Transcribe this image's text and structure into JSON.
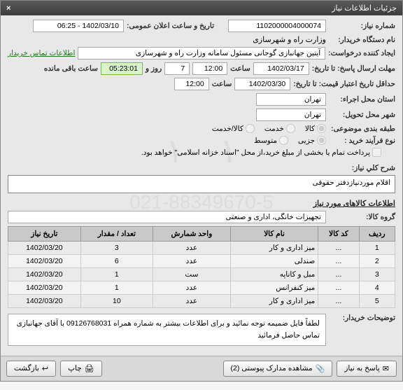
{
  "window": {
    "title": "جزئیات اطلاعات نیاز"
  },
  "fields": {
    "need_no_label": "شماره نیاز:",
    "need_no": "1102000004000074",
    "announce_label": "تاریخ و ساعت اعلان عمومی:",
    "announce_value": "1402/03/10 - 06:25",
    "buyer_label": "نام دستگاه خریدار:",
    "buyer_value": "وزارت راه و شهرسازی",
    "creator_label": "ایجاد کننده درخواست:",
    "creator_value": "آیتین جهانبازی گوجانی مسئول سامانه وزارت راه و شهرسازی",
    "contact_link": "اطلاعات تماس خریدار",
    "deadline_from_label": "مهلت ارسال پاسخ: تا تاریخ:",
    "deadline_date": "1402/03/17",
    "time_label": "ساعت",
    "deadline_time": "12:00",
    "days_label": "روز و",
    "days_value": "7",
    "remain_label": "ساعت باقی مانده",
    "remain_value": "05:23:01",
    "validity_label": "حداقل تاریخ اعتبار قیمت: تا تاریخ:",
    "validity_date": "1402/03/30",
    "validity_time": "12:00",
    "exec_loc_label": "استان محل اجراء:",
    "exec_loc": "تهران",
    "deliver_loc_label": "شهر محل تحویل:",
    "deliver_loc": "تهران",
    "category_label": "طبقه بندی موضوعی:",
    "cat_goods": "کالا",
    "cat_service": "خدمت",
    "cat_goods_service": "کالا/خدمت",
    "process_label": "نوع فرآیند خرید :",
    "proc_small": "جزیی",
    "proc_medium": "متوسط",
    "payment_note": "پرداخت تمام یا بخشی از مبلغ خرید،از محل \"اسناد خزانه اسلامی\" خواهد بود.",
    "desc_title_label": "شرح کلي نياز:",
    "desc_value": "اقلام موردنیازدفتر حقوقی",
    "goods_section": "اطلاعات کالاهای مورد نیاز",
    "group_label": "گروه کالا:",
    "group_value": "تجهیزات خانگی، اداری و صنعتی",
    "buyer_notes_label": "توضیحات خریدار:",
    "buyer_notes": "لطفاً فایل ضمیمه توجه نمائید و برای اطلاعات بیشتر به شماره همراه 09126768031 با آقای جهانبازی تماس حاصل فرمائید"
  },
  "table": {
    "headers": [
      "ردیف",
      "کد کالا",
      "نام کالا",
      "واحد شمارش",
      "تعداد / مقدار",
      "تاریخ نیاز"
    ],
    "rows": [
      {
        "n": "1",
        "code": "...",
        "name": "میز اداری و کار",
        "unit": "عدد",
        "qty": "3",
        "date": "1402/03/20"
      },
      {
        "n": "2",
        "code": "...",
        "name": "صندلی",
        "unit": "عدد",
        "qty": "6",
        "date": "1402/03/20"
      },
      {
        "n": "3",
        "code": "...",
        "name": "مبل و کاناپه",
        "unit": "ست",
        "qty": "1",
        "date": "1402/03/20"
      },
      {
        "n": "4",
        "code": "...",
        "name": "میز کنفرانس",
        "unit": "عدد",
        "qty": "1",
        "date": "1402/03/20"
      },
      {
        "n": "5",
        "code": "...",
        "name": "میز اداری و کار",
        "unit": "عدد",
        "qty": "10",
        "date": "1402/03/20"
      }
    ]
  },
  "footer": {
    "reply": "پاسخ به نیاز",
    "attachments": "مشاهده مدارک پیوستی (2)",
    "print": "چاپ",
    "back": "بازگشت"
  },
  "watermark": {
    "line1": "۱۰۰۱",
    "line2": "021-88349670-5"
  }
}
